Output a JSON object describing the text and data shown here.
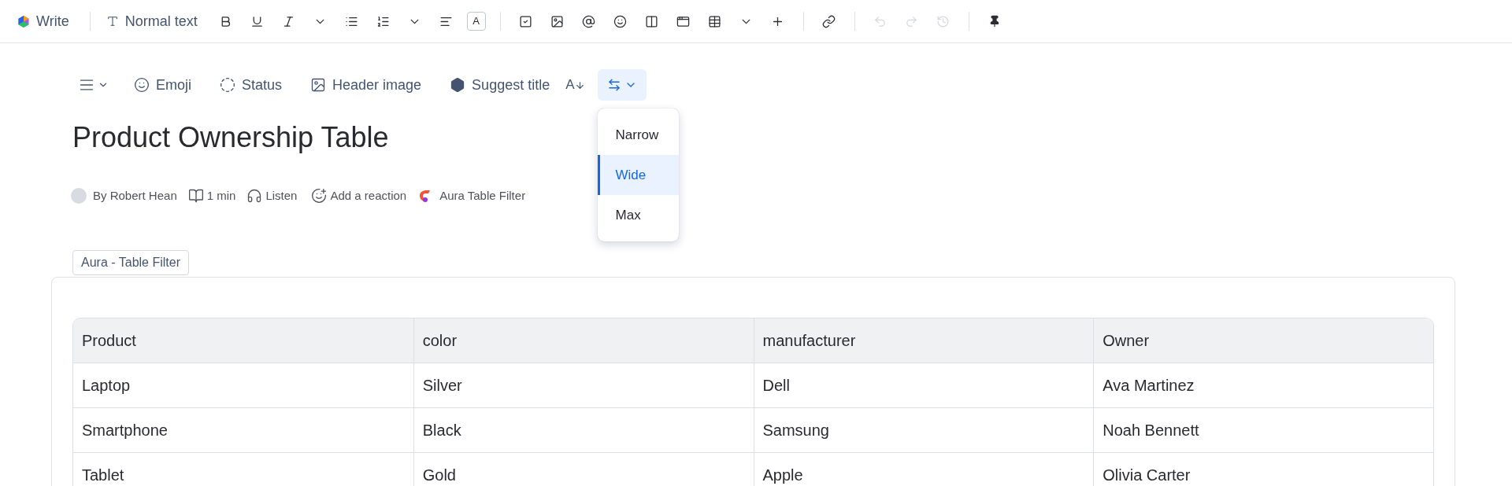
{
  "editor_toolbar": {
    "mode_label": "Write",
    "text_style": "Normal text",
    "items": [
      {
        "kind": "bold",
        "disabled": false
      },
      {
        "kind": "underline",
        "disabled": false
      },
      {
        "kind": "italic",
        "disabled": false
      },
      {
        "kind": "chevron",
        "disabled": false
      },
      {
        "kind": "bullets",
        "disabled": false
      },
      {
        "kind": "numbered",
        "disabled": false
      },
      {
        "kind": "chevron",
        "disabled": false
      },
      {
        "kind": "align",
        "disabled": false
      },
      {
        "kind": "text_color",
        "label": "A",
        "disabled": false
      },
      {
        "kind": "divider"
      },
      {
        "kind": "task",
        "disabled": false
      },
      {
        "kind": "image",
        "disabled": false
      },
      {
        "kind": "mention",
        "disabled": false
      },
      {
        "kind": "emoji",
        "disabled": false
      },
      {
        "kind": "columns",
        "disabled": false
      },
      {
        "kind": "embed",
        "disabled": false
      },
      {
        "kind": "table",
        "disabled": false
      },
      {
        "kind": "chevron",
        "disabled": false
      },
      {
        "kind": "plus",
        "disabled": false
      },
      {
        "kind": "divider"
      },
      {
        "kind": "link",
        "disabled": false
      },
      {
        "kind": "divider"
      },
      {
        "kind": "undo",
        "disabled": true
      },
      {
        "kind": "redo",
        "disabled": true
      },
      {
        "kind": "history",
        "disabled": true
      },
      {
        "kind": "divider"
      },
      {
        "kind": "pin",
        "disabled": false
      }
    ]
  },
  "page_toolbar": {
    "buttons": [
      {
        "kind": "layout"
      },
      {
        "kind": "emoji",
        "label": "Emoji"
      },
      {
        "kind": "status",
        "label": "Status"
      },
      {
        "kind": "header_image",
        "label": "Header image"
      },
      {
        "kind": "suggest_title",
        "label": "Suggest title"
      },
      {
        "kind": "font_size",
        "label": "A"
      }
    ],
    "width_button": {
      "expanded": true
    },
    "width_options": [
      {
        "label": "Narrow",
        "selected": false
      },
      {
        "label": "Wide",
        "selected": true
      },
      {
        "label": "Max",
        "selected": false
      }
    ]
  },
  "title": "Product Ownership Table",
  "byline": {
    "author": "By Robert Hean",
    "read_time": "1 min",
    "listen": "Listen",
    "reaction": "Add a reaction",
    "app": "Aura Table Filter"
  },
  "macro_tag": "Aura - Table Filter",
  "table": {
    "columns": [
      "Product",
      "color",
      "manufacturer",
      "Owner"
    ],
    "rows": [
      [
        "Laptop",
        "Silver",
        "Dell",
        "Ava Martinez"
      ],
      [
        "Smartphone",
        "Black",
        "Samsung",
        "Noah Bennett"
      ],
      [
        "Tablet",
        "Gold",
        "Apple",
        "Olivia Carter"
      ]
    ]
  }
}
